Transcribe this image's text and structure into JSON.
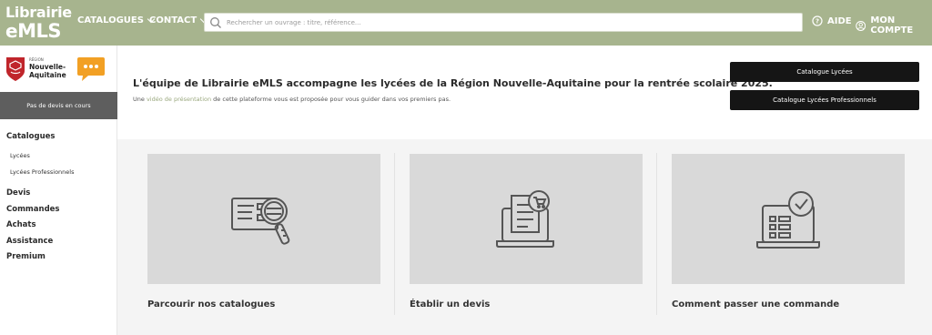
{
  "header": {
    "logo_line1": "Librairie",
    "logo_line2_e": "e",
    "logo_line2_rest": "MLS",
    "nav": [
      {
        "label": "CATALOGUES"
      },
      {
        "label": "CONTACT"
      }
    ],
    "search_placeholder": "Rechercher un ouvrage : titre, référence...",
    "aide_label": "AIDE",
    "account_label": "MON COMPTE",
    "colors": {
      "bar": "#a7b48e",
      "accent": "#9aa87e"
    }
  },
  "sidebar": {
    "region_small": "RÉGION",
    "region_name_line1": "Nouvelle-",
    "region_name_line2": "Aquitaine",
    "devis_status": "Pas de devis en cours",
    "menu": {
      "catalogues": "Catalogues",
      "lycees": "Lycées",
      "lycees_pro": "Lycées Professionnels",
      "devis": "Devis",
      "commandes": "Commandes",
      "achats": "Achats",
      "assistance": "Assistance",
      "premium": "Premium"
    }
  },
  "banner": {
    "title": "L'équipe de Librairie eMLS accompagne les lycées de la Région Nouvelle-Aquitaine pour la rentrée scolaire 2025.",
    "text_before": "Une ",
    "text_link": "vidéo de présentation",
    "text_after": " de cette plateforme vous est proposée pour vous guider dans vos premiers pas.",
    "btn_lycees": "Catalogue Lycées",
    "btn_lycees_pro": "Catalogue Lycées Professionnels"
  },
  "cards": [
    {
      "label": "Parcourir nos catalogues",
      "icon": "catalog-search-icon"
    },
    {
      "label": "Établir un devis",
      "icon": "quote-cart-icon"
    },
    {
      "label": "Comment passer une commande",
      "icon": "order-check-icon"
    }
  ]
}
